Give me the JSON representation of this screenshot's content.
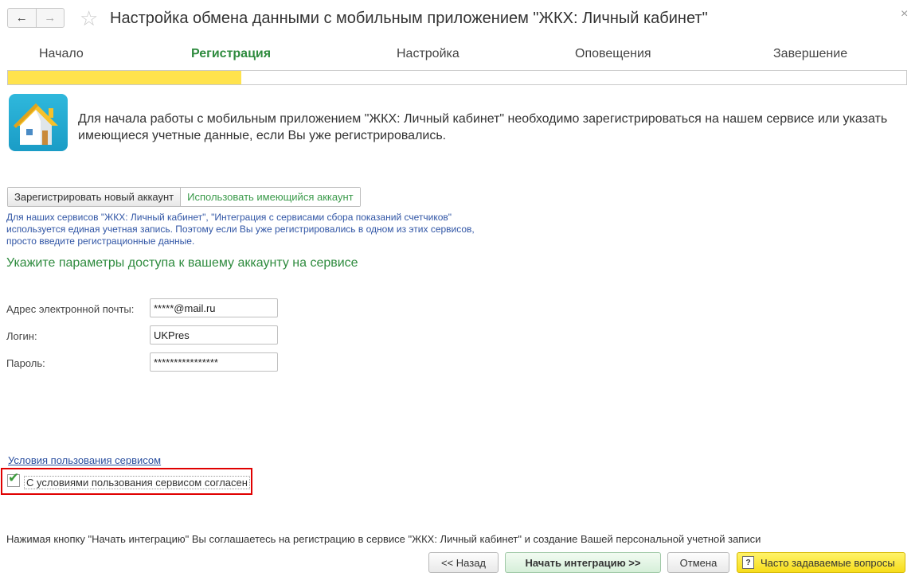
{
  "window": {
    "title": "Настройка обмена данными с мобильным приложением \"ЖКХ: Личный кабинет\"",
    "back_glyph": "←",
    "forward_glyph": "→",
    "favorite_glyph": "☆",
    "close_glyph": "×"
  },
  "steps": [
    {
      "label": "Начало",
      "active": false
    },
    {
      "label": "Регистрация",
      "active": true
    },
    {
      "label": "Настройка",
      "active": false
    },
    {
      "label": "Оповещения",
      "active": false
    },
    {
      "label": "Завершение",
      "active": false
    }
  ],
  "progress": {
    "fraction": 0.26,
    "color": "#ffe34d"
  },
  "intro_text": "Для начала работы с мобильным приложением \"ЖКХ: Личный кабинет\" необходимо зарегистрироваться на нашем сервисе или указать имеющиеся учетные данные, если Вы уже регистрировались.",
  "account_toggle": {
    "register_label": "Зарегистрировать новый аккаунт",
    "existing_label": "Использовать имеющийся аккаунт"
  },
  "note_lines": [
    "Для наших сервисов \"ЖКХ: Личный кабинет\", \"Интеграция с сервисами сбора показаний счетчиков\"",
    "используется единая учетная запись. Поэтому если Вы уже регистрировались в одном из этих сервисов,",
    "просто введите регистрационные данные."
  ],
  "section_title": "Укажите параметры доступа к вашему аккаунту на сервисе",
  "form": {
    "email_label": "Адрес электронной почты:",
    "email_value": "*****@mail.ru",
    "login_label": "Логин:",
    "login_value": "UKPres",
    "password_label": "Пароль:",
    "password_value": "****************"
  },
  "terms_link": "Условия пользования сервисом",
  "consent": {
    "label": "С условиями пользования сервисом согласен",
    "checked": true
  },
  "footer_note": "Нажимая кнопку \"Начать интеграцию\" Вы соглашаетесь на регистрацию в сервисе \"ЖКХ: Личный кабинет\" и создание Вашей персональной учетной записи",
  "buttons": {
    "back": "<< Назад",
    "start": "Начать интеграцию >>",
    "cancel": "Отмена",
    "faq": "Часто задаваемые вопросы"
  },
  "colors": {
    "accent_green": "#2e8b3e",
    "link_blue": "#2a4fa0",
    "highlight_red": "#e00000",
    "faq_yellow": "#f7dd1b"
  }
}
